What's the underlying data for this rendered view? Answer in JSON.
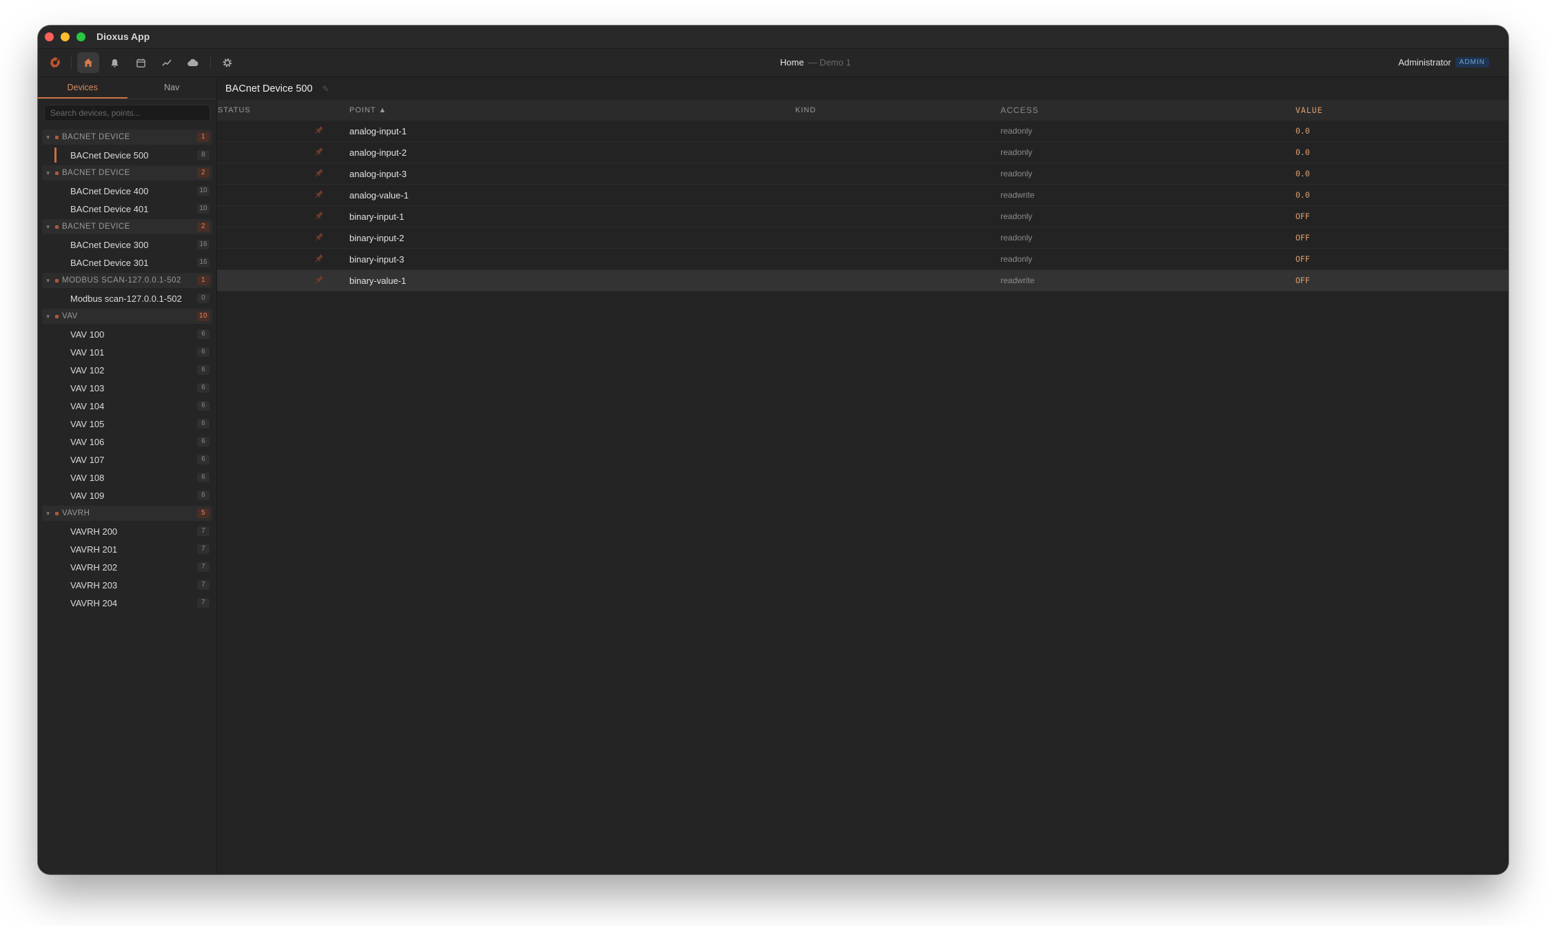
{
  "window": {
    "title": "Dioxus App"
  },
  "toolbar": {
    "icons": [
      "logo-icon",
      "home-icon",
      "bell-icon",
      "calendar-icon",
      "chart-line-icon",
      "cloud-icon",
      "gear-icon"
    ],
    "breadcrumb": {
      "title": "Home",
      "subtitle": "— Demo 1"
    },
    "user": {
      "name": "Administrator",
      "role": "ADMIN"
    }
  },
  "sidebar": {
    "tabs": [
      {
        "label": "Devices"
      },
      {
        "label": "Nav"
      }
    ],
    "search_placeholder": "Search devices, points...",
    "groups": [
      {
        "name": "BACNET DEVICE",
        "count": "1",
        "devices": [
          {
            "name": "BACnet Device 500",
            "count": "8"
          }
        ]
      },
      {
        "name": "BACNET DEVICE",
        "count": "2",
        "devices": [
          {
            "name": "BACnet Device 400",
            "count": "10"
          },
          {
            "name": "BACnet Device 401",
            "count": "10"
          }
        ]
      },
      {
        "name": "BACNET DEVICE",
        "count": "2",
        "devices": [
          {
            "name": "BACnet Device 300",
            "count": "16"
          },
          {
            "name": "BACnet Device 301",
            "count": "16"
          }
        ]
      },
      {
        "name": "MODBUS SCAN-127.0.0.1-502",
        "count": "1",
        "devices": [
          {
            "name": "Modbus scan-127.0.0.1-502",
            "count": "0"
          }
        ]
      },
      {
        "name": "VAV",
        "count": "10",
        "devices": [
          {
            "name": "VAV 100",
            "count": "6"
          },
          {
            "name": "VAV 101",
            "count": "6"
          },
          {
            "name": "VAV 102",
            "count": "6"
          },
          {
            "name": "VAV 103",
            "count": "6"
          },
          {
            "name": "VAV 104",
            "count": "6"
          },
          {
            "name": "VAV 105",
            "count": "6"
          },
          {
            "name": "VAV 106",
            "count": "6"
          },
          {
            "name": "VAV 107",
            "count": "6"
          },
          {
            "name": "VAV 108",
            "count": "6"
          },
          {
            "name": "VAV 109",
            "count": "6"
          }
        ]
      },
      {
        "name": "VAVRH",
        "count": "5",
        "devices": [
          {
            "name": "VAVRH 200",
            "count": "7"
          },
          {
            "name": "VAVRH 201",
            "count": "7"
          },
          {
            "name": "VAVRH 202",
            "count": "7"
          },
          {
            "name": "VAVRH 203",
            "count": "7"
          },
          {
            "name": "VAVRH 204",
            "count": "7"
          }
        ]
      }
    ]
  },
  "main": {
    "title": "BACnet Device 500",
    "columns": {
      "status": "STATUS",
      "point": "POINT ▲",
      "kind": "KIND",
      "access": "ACCESS",
      "value": "VALUE"
    },
    "rows": [
      {
        "point": "analog-input-1",
        "kind": "",
        "access": "readonly",
        "value": "0.0"
      },
      {
        "point": "analog-input-2",
        "kind": "",
        "access": "readonly",
        "value": "0.0"
      },
      {
        "point": "analog-input-3",
        "kind": "",
        "access": "readonly",
        "value": "0.0"
      },
      {
        "point": "analog-value-1",
        "kind": "",
        "access": "readwrite",
        "value": "0.0"
      },
      {
        "point": "binary-input-1",
        "kind": "",
        "access": "readonly",
        "value": "OFF"
      },
      {
        "point": "binary-input-2",
        "kind": "",
        "access": "readonly",
        "value": "OFF"
      },
      {
        "point": "binary-input-3",
        "kind": "",
        "access": "readonly",
        "value": "OFF"
      },
      {
        "point": "binary-value-1",
        "kind": "",
        "access": "readwrite",
        "value": "OFF"
      }
    ],
    "highlighted_row": 7
  },
  "colors": {
    "accent": "#c86f45",
    "value": "#e0a070",
    "admin_badge": "#6fa2e0"
  }
}
